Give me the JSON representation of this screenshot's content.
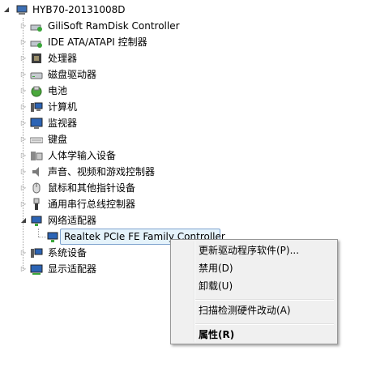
{
  "tree": {
    "root": {
      "label": "HYB70-20131008D",
      "icon": "computer-icon"
    },
    "items": [
      {
        "label": "GiliSoft RamDisk Controller",
        "icon": "disk-controller-icon"
      },
      {
        "label": "IDE ATA/ATAPI 控制器",
        "icon": "ide-controller-icon"
      },
      {
        "label": "处理器",
        "icon": "processor-icon"
      },
      {
        "label": "磁盘驱动器",
        "icon": "disk-drive-icon"
      },
      {
        "label": "电池",
        "icon": "battery-icon"
      },
      {
        "label": "计算机",
        "icon": "computer-icon"
      },
      {
        "label": "监视器",
        "icon": "monitor-icon"
      },
      {
        "label": "键盘",
        "icon": "keyboard-icon"
      },
      {
        "label": "人体学输入设备",
        "icon": "hid-icon"
      },
      {
        "label": "声音、视频和游戏控制器",
        "icon": "speaker-icon"
      },
      {
        "label": "鼠标和其他指针设备",
        "icon": "mouse-icon"
      },
      {
        "label": "通用串行总线控制器",
        "icon": "usb-icon"
      },
      {
        "label": "网络适配器",
        "icon": "network-icon"
      }
    ],
    "network_child": {
      "label": "Realtek PCIe FE Family Controller",
      "icon": "network-adapter-icon"
    },
    "after": [
      {
        "label": "系统设备",
        "icon": "system-devices-icon"
      },
      {
        "label": "显示适配器",
        "icon": "display-adapter-icon"
      }
    ]
  },
  "context_menu": {
    "items": [
      {
        "label": "更新驱动程序软件(P)..."
      },
      {
        "label": "禁用(D)"
      },
      {
        "label": "卸载(U)"
      },
      {
        "label": "扫描检测硬件改动(A)"
      },
      {
        "label": "属性(R)"
      }
    ]
  },
  "colors": {
    "selection_bg": "#e5f3fb",
    "selection_border": "#7da2ce",
    "menu_bg": "#f0f0f0"
  }
}
